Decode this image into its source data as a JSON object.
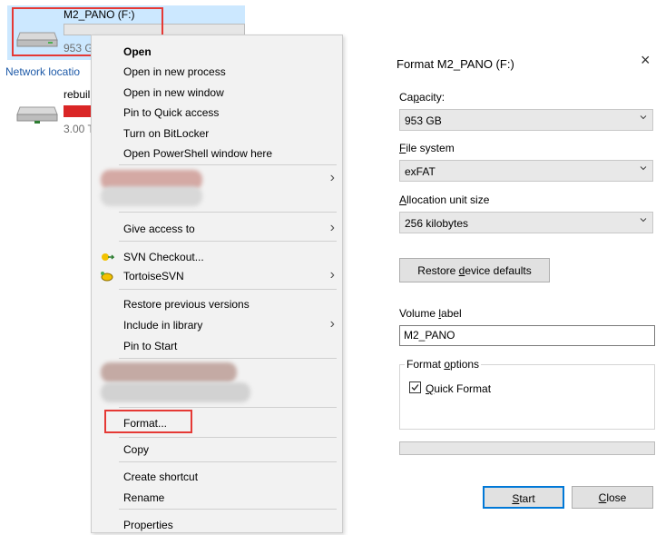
{
  "explorer": {
    "selected_drive": {
      "name": "M2_PANO (F:)",
      "usage_text": "953 G",
      "used_fraction": 0.0
    },
    "network_header": "Network locatio",
    "second_drive": {
      "name": "rebuil",
      "usage_text": "3.00 T",
      "used_fraction": 1.0
    }
  },
  "context_menu": {
    "items": [
      {
        "label": "Open"
      },
      {
        "label": "Open in new process"
      },
      {
        "label": "Open in new window"
      },
      {
        "label": "Pin to Quick access"
      },
      {
        "label": "Turn on BitLocker"
      },
      {
        "label": "Open PowerShell window here"
      },
      {
        "label": "Give access to"
      },
      {
        "label": "SVN Checkout..."
      },
      {
        "label": "TortoiseSVN"
      },
      {
        "label": "Restore previous versions"
      },
      {
        "label": "Include in library"
      },
      {
        "label": "Pin to Start"
      },
      {
        "label": "Format..."
      },
      {
        "label": "Copy"
      },
      {
        "label": "Create shortcut"
      },
      {
        "label": "Rename"
      },
      {
        "label": "Properties"
      }
    ]
  },
  "dialog": {
    "title": "Format M2_PANO (F:)",
    "close_glyph": "×",
    "capacity": {
      "label_prefix": "Ca",
      "label_ul": "p",
      "label_rest": "acity:",
      "value": "953 GB"
    },
    "file_system": {
      "label_prefix": "",
      "label_ul": "F",
      "label_rest": "ile system",
      "value": "exFAT"
    },
    "allocation": {
      "label_prefix": "",
      "label_ul": "A",
      "label_rest": "llocation unit size",
      "value": "256 kilobytes"
    },
    "restore_button": {
      "prefix": "Restore ",
      "ul": "d",
      "rest": "evice defaults"
    },
    "volume_label": {
      "label_prefix": "Volume ",
      "label_ul": "l",
      "label_rest": "abel",
      "value": "M2_PANO"
    },
    "format_options": {
      "legend_prefix": "Format ",
      "legend_ul": "o",
      "legend_rest": "ptions"
    },
    "quick_format": {
      "ul": "Q",
      "rest": "uick Format",
      "checked": true
    },
    "progress": 0,
    "start_button": {
      "ul": "S",
      "rest": "tart"
    },
    "close_button": {
      "ul": "C",
      "rest": "lose"
    }
  },
  "colors": {
    "highlight": "#e53935",
    "selection": "#cce8ff",
    "accent": "#0078d7",
    "full_drive": "#da2626"
  }
}
